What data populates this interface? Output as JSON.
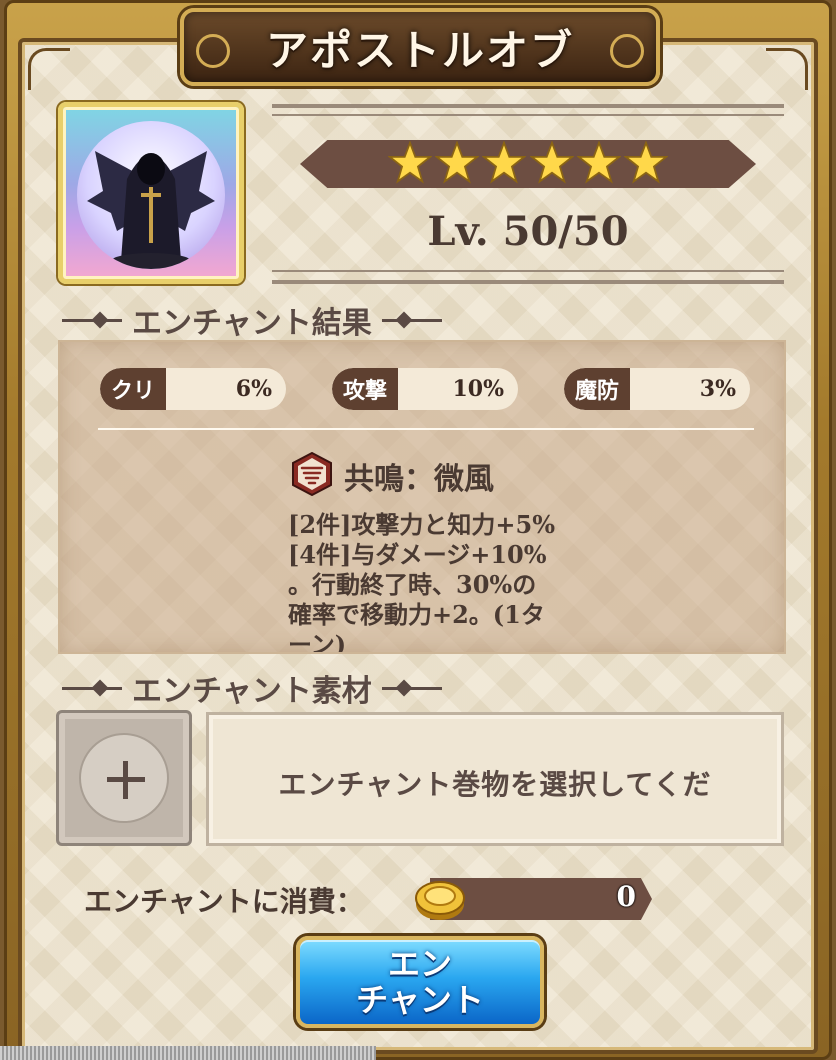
{
  "window": {
    "title": "アポストルオブ"
  },
  "character": {
    "icon": "hooded-reaper-portrait",
    "stars": 6,
    "star_icon": "gold-star-icon",
    "level_text": "Lv.  50/50"
  },
  "results": {
    "header": "エンチャント結果",
    "stats": [
      {
        "name": "クリ",
        "value": "6%"
      },
      {
        "name": "攻撃",
        "value": "10%"
      },
      {
        "name": "魔防",
        "value": "3%"
      }
    ],
    "set_icon": "whirlwind-icon",
    "set_title": "共鳴：微風",
    "set_desc_lines": [
      "[2件]攻撃力と知力+5%",
      "[4件]与ダメージ+10%",
      "。行動終了時、30%の",
      "確率で移動力+2。(1タ",
      "ーン)"
    ]
  },
  "material": {
    "header": "エンチャント素材",
    "slot_icon": "plus-icon",
    "prompt": "エンチャント巻物を選択してくだ"
  },
  "cost": {
    "label": "エンチャントに消費：",
    "coin_icon": "gold-coin-icon",
    "value": "0"
  },
  "button": {
    "line1": "エン",
    "line2": "チャント"
  },
  "colors": {
    "panel_bg": "#ece0c8",
    "dark_brown": "#6d4e42",
    "button_blue": "#2aa7f0",
    "gold": "#d4ad55"
  }
}
